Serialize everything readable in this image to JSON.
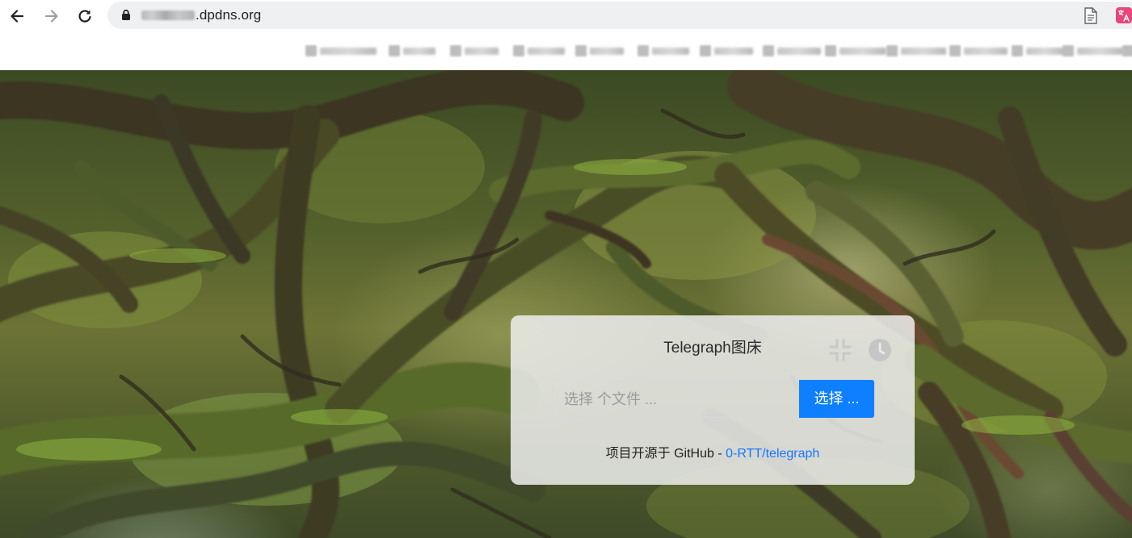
{
  "browser": {
    "url_domain": ".dpdns.org"
  },
  "card": {
    "title": "Telegraph图床",
    "file_placeholder": "选择 个文件 ...",
    "choose_button": "选择 ...",
    "footer_prefix": "项目开源于 GitHub - ",
    "footer_link": "0-RTT/telegraph"
  },
  "colors": {
    "primary_button": "#0d7fff",
    "link": "#1677ff"
  },
  "icons": [
    "back-arrow-icon",
    "forward-arrow-icon",
    "reload-icon",
    "lock-icon",
    "reader-mode-icon",
    "translate-icon",
    "compress-icon",
    "history-icon"
  ]
}
